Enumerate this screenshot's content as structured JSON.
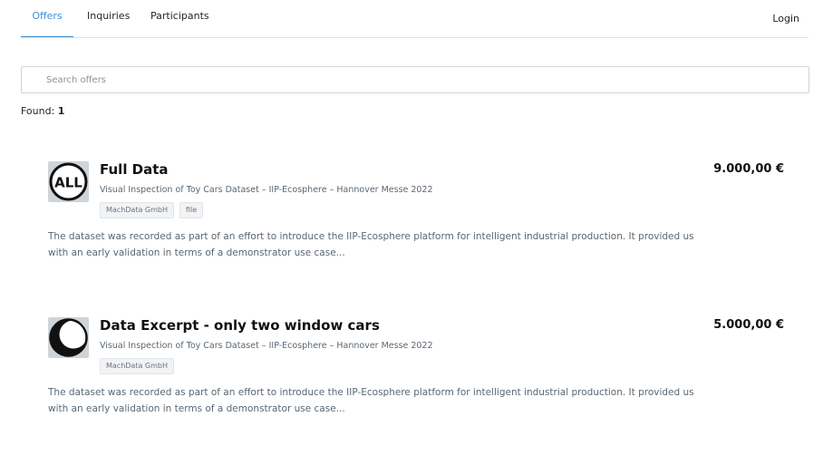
{
  "nav": {
    "tabs": [
      {
        "label": "Offers",
        "active": true
      },
      {
        "label": "Inquiries",
        "active": false
      },
      {
        "label": "Participants",
        "active": false
      }
    ],
    "login_label": "Login",
    "accent_color": "#3a8fd9"
  },
  "search": {
    "placeholder": "Search offers",
    "value": ""
  },
  "results": {
    "found_label": "Found:",
    "found_count": "1"
  },
  "offers": [
    {
      "icon": "all-badge-icon",
      "title": "Full Data",
      "subtitle": "Visual Inspection of Toy Cars Dataset – IIP-Ecosphere – Hannover Messe 2022",
      "tags": [
        "MachData GmbH",
        "file"
      ],
      "description": "The dataset was recorded as part of an effort to introduce the IIP-Ecosphere platform for intelligent industrial production. It provided us with an early validation in terms of a demonstrator use case...",
      "price": "9.000,00 €"
    },
    {
      "icon": "crescent-excerpt-icon",
      "title": "Data Excerpt - only two window cars",
      "subtitle": "Visual Inspection of Toy Cars Dataset – IIP-Ecosphere – Hannover Messe 2022",
      "tags": [
        "MachData GmbH"
      ],
      "description": "The dataset was recorded as part of an effort to introduce the IIP-Ecosphere platform for intelligent industrial production. It provided us with an early validation in terms of a demonstrator use case...",
      "price": "5.000,00 €"
    }
  ]
}
